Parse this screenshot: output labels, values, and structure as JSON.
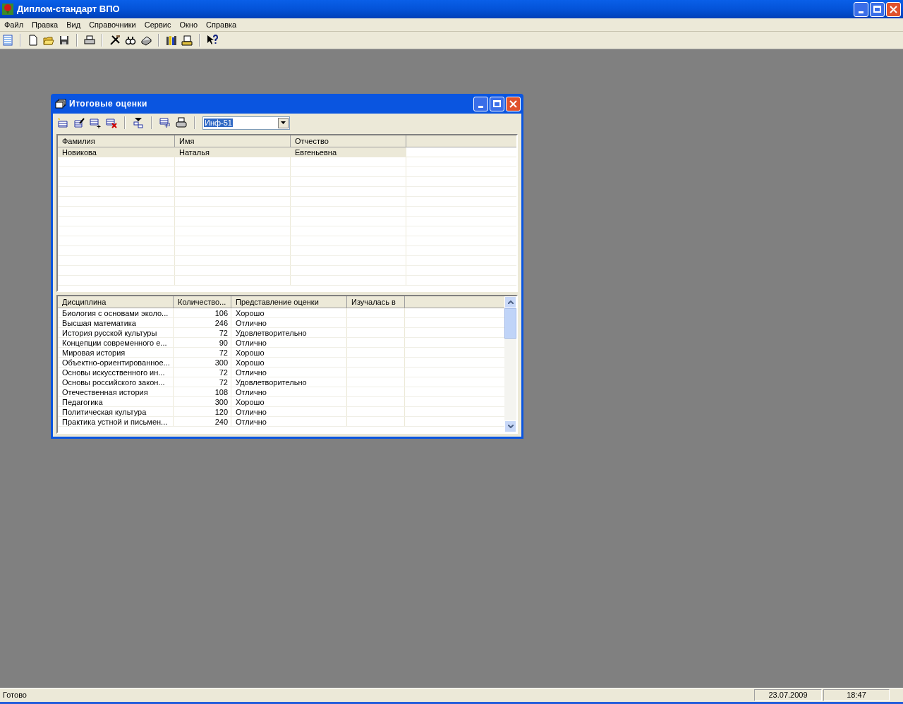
{
  "window": {
    "title": "Диплом-стандарт ВПО"
  },
  "menu": [
    "Файл",
    "Правка",
    "Вид",
    "Справочники",
    "Сервис",
    "Окно",
    "Справка"
  ],
  "child_window": {
    "title": "Итоговые оценки",
    "group_combo": {
      "value": "Инф-51"
    },
    "students": {
      "columns": [
        "Фамилия",
        "Имя",
        "Отчество"
      ],
      "rows": [
        {
          "cells": [
            "Новикова",
            "Наталья",
            "Евгеньевна"
          ],
          "selected": true
        }
      ]
    },
    "grades": {
      "columns": [
        "Дисциплина",
        "Количество...",
        "Представление оценки",
        "Изучалась в"
      ],
      "rows": [
        [
          "Биология с основами эколо...",
          "106",
          "Хорошо"
        ],
        [
          "Высшая математика",
          "246",
          "Отлично"
        ],
        [
          "История русской культуры",
          "72",
          "Удовлетворительно"
        ],
        [
          "Концепции современного е...",
          "90",
          "Отлично"
        ],
        [
          "Мировая история",
          "72",
          "Хорошо"
        ],
        [
          "Объектно-ориентированное...",
          "300",
          "Хорошо"
        ],
        [
          "Основы искусственного ин...",
          "72",
          "Отлично"
        ],
        [
          "Основы российского закон...",
          "72",
          "Удовлетворительно"
        ],
        [
          "Отечественная история",
          "108",
          "Отлично"
        ],
        [
          "Педагогика",
          "300",
          "Хорошо"
        ],
        [
          "Политическая культура",
          "120",
          "Отлично"
        ],
        [
          "Практика устной и письмен...",
          "240",
          "Отлично"
        ]
      ]
    }
  },
  "status_bar": {
    "message": "Готово",
    "date": "23.07.2009",
    "time": "18:47"
  }
}
